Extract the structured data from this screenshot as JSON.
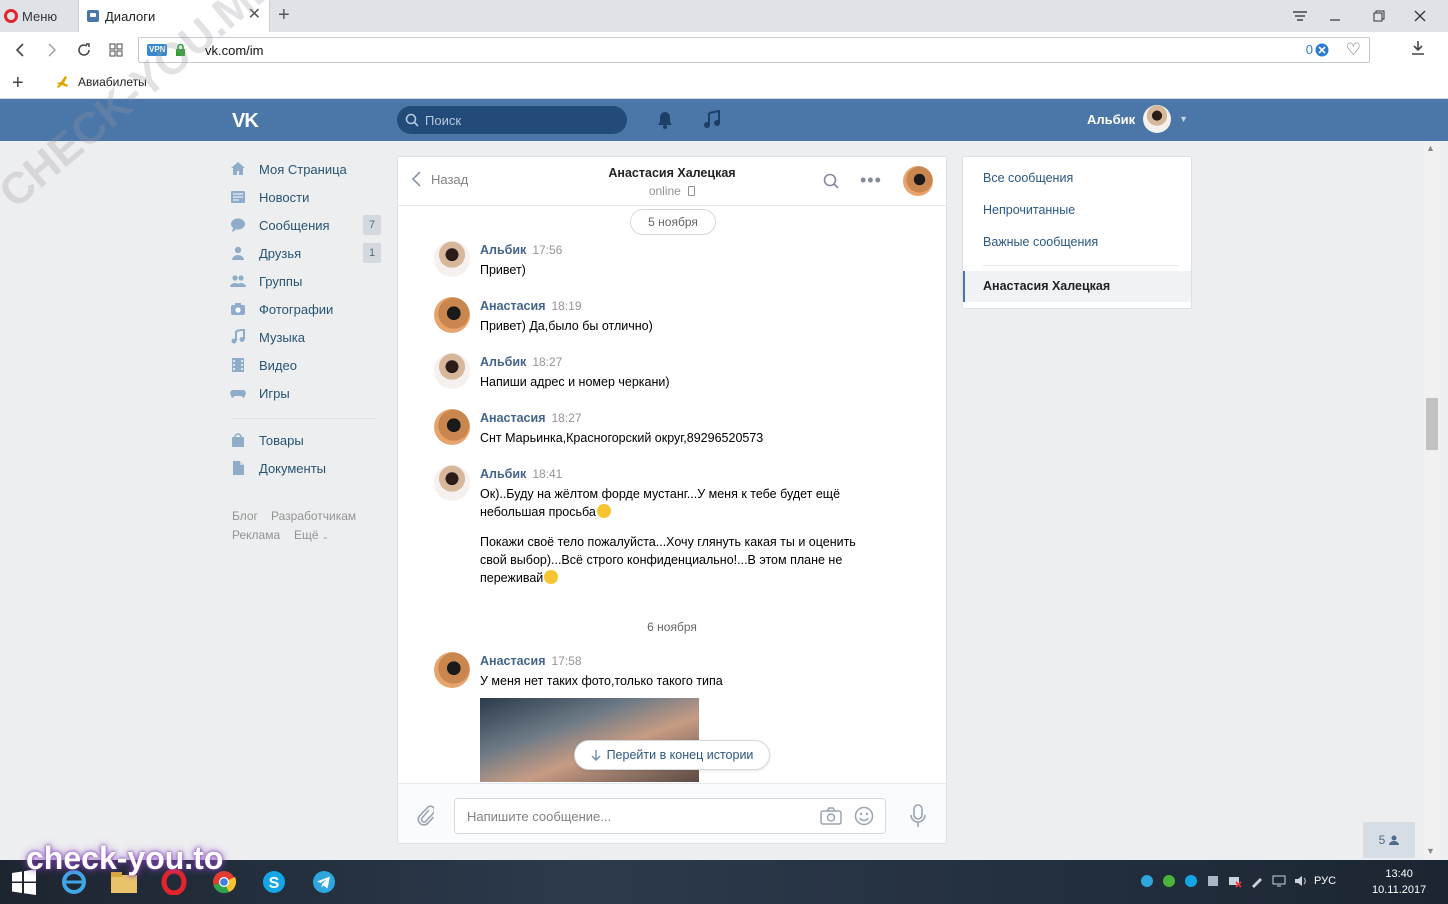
{
  "browser": {
    "menu_label": "Меню",
    "tab_title": "Диалоги",
    "url": "vk.com/im",
    "blocked_count": "0",
    "bookmark": "Авиабилеты"
  },
  "vk_header": {
    "search_placeholder": "Поиск",
    "user_name": "Альбик"
  },
  "left_menu": {
    "items": [
      {
        "label": "Моя Страница",
        "icon": "home-icon"
      },
      {
        "label": "Новости",
        "icon": "news-icon"
      },
      {
        "label": "Сообщения",
        "icon": "messages-icon",
        "badge": "7"
      },
      {
        "label": "Друзья",
        "icon": "friends-icon",
        "badge": "1"
      },
      {
        "label": "Группы",
        "icon": "groups-icon"
      },
      {
        "label": "Фотографии",
        "icon": "camera-icon"
      },
      {
        "label": "Музыка",
        "icon": "music-icon"
      },
      {
        "label": "Видео",
        "icon": "video-icon"
      },
      {
        "label": "Игры",
        "icon": "games-icon"
      }
    ],
    "items2": [
      {
        "label": "Товары",
        "icon": "goods-icon"
      },
      {
        "label": "Документы",
        "icon": "documents-icon"
      }
    ],
    "footer": [
      "Блог",
      "Разработчикам",
      "Реклама",
      "Ещё"
    ]
  },
  "chat": {
    "back_label": "Назад",
    "contact_name": "Анастасия Халецкая",
    "contact_status": "online",
    "date1": "5 ноября",
    "date2": "6 ноября",
    "messages": [
      {
        "author": "Альбик",
        "time": "17:56",
        "text": "Привет)"
      },
      {
        "author": "Анастасия",
        "time": "18:19",
        "text": "Привет) Да,было бы отлично)"
      },
      {
        "author": "Альбик",
        "time": "18:27",
        "text": "Напиши адрес и номер черкани)"
      },
      {
        "author": "Анастасия",
        "time": "18:27",
        "text": "Снт Марьинка,Красногорский округ,89296520573"
      },
      {
        "author": "Альбик",
        "time": "18:41",
        "text1": "Ок)..Буду на жёлтом форде мустанг...У меня к тебе будет ещё небольшая просьба",
        "text2": "Покажи своё тело пожалуйста...Хочу глянуть какая ты и оценить свой выбор)...Всё строго конфиденциально!...В этом плане не переживай"
      },
      {
        "author": "Анастасия",
        "time": "17:58",
        "text": "У меня нет таких фото,только такого типа"
      }
    ],
    "jump_label": "Перейти в конец истории",
    "input_placeholder": "Напишите сообщение..."
  },
  "right_panel": {
    "items": [
      "Все сообщения",
      "Непрочитанные",
      "Важные сообщения"
    ],
    "active": "Анастасия Халецкая"
  },
  "online_friends": "5",
  "taskbar": {
    "lang": "РУС",
    "time": "13:40",
    "date": "10.11.2017"
  },
  "watermarks": [
    "CHECK-YOU.ME",
    "check-you.to"
  ],
  "colors": {
    "vk_blue": "#4a76a8",
    "link": "#2a5885",
    "author": "#42648b"
  }
}
